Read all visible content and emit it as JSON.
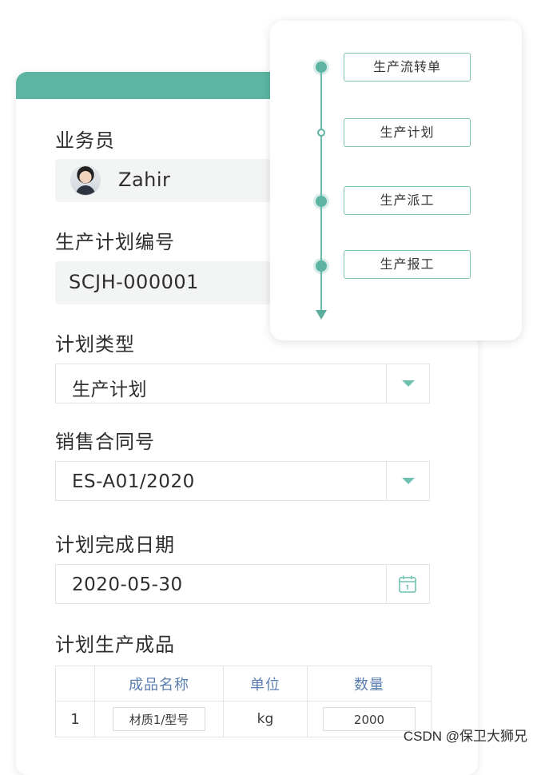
{
  "form": {
    "salesperson_label": "业务员",
    "salesperson_name": "Zahir",
    "plan_no_label": "生产计划编号",
    "plan_no_value": "SCJH-000001",
    "plan_type_label": "计划类型",
    "plan_type_value": "生产计划",
    "contract_label": "销售合同号",
    "contract_value": "ES-A01/2020",
    "finish_date_label": "计划完成日期",
    "finish_date_value": "2020-05-30",
    "products_label": "计划生产成品"
  },
  "product_table": {
    "headers": [
      "",
      "成品名称",
      "单位",
      "数量"
    ],
    "rows": [
      {
        "index": "1",
        "name": "材质1/型号",
        "unit": "kg",
        "quantity": "2000"
      }
    ]
  },
  "flow": {
    "steps": [
      "生产流转单",
      "生产计划",
      "生产派工",
      "生产报工"
    ]
  },
  "watermark": "CSDN @保卫大狮兄",
  "colors": {
    "accent": "#5cb5a2",
    "table_header_text": "#5a7eb0"
  },
  "icons": {
    "select_caret": "caret-down-icon",
    "date_picker": "calendar-icon"
  }
}
